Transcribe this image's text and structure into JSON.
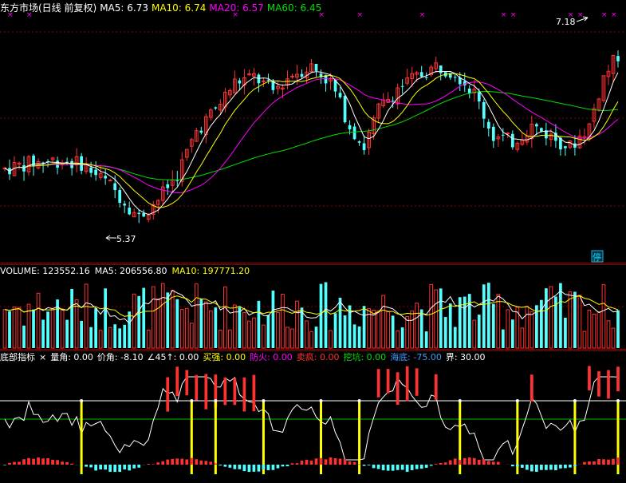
{
  "colors": {
    "background": "#000000",
    "grid_red": "#8a0000",
    "up": "#ff3232",
    "down": "#54ffff",
    "ma5": "#ffffff",
    "ma10": "#ffff00",
    "ma20": "#ff00ff",
    "ma60": "#00e000",
    "label_white": "#ffffff",
    "indicator_line": "#ffffff",
    "indicator_green_level": "#00c000",
    "indicator_white_level": "#ffffff",
    "yellow_bar": "#ffff00"
  },
  "price_panel": {
    "legend": [
      {
        "text": "东方市场(日线 前复权)",
        "color": "#ffffff"
      },
      {
        "text": "MA5: 6.73",
        "color": "#ffffff"
      },
      {
        "text": "MA10: 6.74",
        "color": "#ffff00"
      },
      {
        "text": "MA20: 6.57",
        "color": "#ff00ff"
      },
      {
        "text": "MA60: 6.45",
        "color": "#00e000"
      }
    ],
    "high_label": "7.18",
    "low_label": "5.37",
    "right_badge": "停",
    "x_markers": "×"
  },
  "volume_panel": {
    "legend": [
      {
        "text": "VOLUME: 123552.16",
        "color": "#ffffff"
      },
      {
        "text": "MA5: 206556.80",
        "color": "#ffffff"
      },
      {
        "text": "MA10: 197771.20",
        "color": "#ffff00"
      }
    ]
  },
  "indicator_panel": {
    "legend": [
      {
        "text": "底部指标",
        "color": "#ffffff"
      },
      {
        "text": "×",
        "color": "#ffffff"
      },
      {
        "text": "量角: 0.00",
        "color": "#ffffff"
      },
      {
        "text": "价角: -8.10",
        "color": "#ffffff"
      },
      {
        "text": "∠45↑: 0.00",
        "color": "#ffffff"
      },
      {
        "text": "买强: 0.00",
        "color": "#ffff00"
      },
      {
        "text": "防火: 0.00",
        "color": "#ff00ff"
      },
      {
        "text": "卖疯: 0.00",
        "color": "#ff3232"
      },
      {
        "text": "挖坑: 0.00",
        "color": "#00e000"
      },
      {
        "text": "海底: -75.00",
        "color": "#3a9cff"
      },
      {
        "text": "界: 30.00",
        "color": "#ffffff"
      }
    ]
  },
  "chart_data": {
    "type": "candlestick",
    "bars": 129,
    "price_ylim": [
      5.2,
      7.4
    ],
    "high_marker": 7.18,
    "low_marker": 5.37,
    "last_ma": {
      "MA5": 6.73,
      "MA10": 6.74,
      "MA20": 6.57,
      "MA60": 6.45
    },
    "last_volume": {
      "VOLUME": 123552.16,
      "MA5": 206556.8,
      "MA10": 197771.2
    },
    "indicator_last": {
      "量角": 0.0,
      "价角": -8.1,
      "∠45↑": 0.0,
      "买强": 0.0,
      "防火": 0.0,
      "卖疯": 0.0,
      "挖坑": 0.0,
      "海底": -75.0,
      "界": 30.0
    }
  }
}
